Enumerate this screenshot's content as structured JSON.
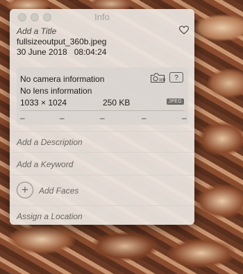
{
  "window": {
    "title": "Info"
  },
  "photo": {
    "title_placeholder": "Add a Title",
    "filename": "fullsizeoutput_360b.jpeg",
    "date": "30 June 2018",
    "time": "08:04:24"
  },
  "camera": {
    "camera_info": "No camera information",
    "lens_info": "No lens information",
    "dimensions": "1033 × 1024",
    "file_size": "250 KB",
    "format_badge": "JPEG",
    "wb_label": "WB",
    "help_label": "?",
    "exif_placeholders": [
      "–",
      "–",
      "–",
      "–",
      "–"
    ]
  },
  "fields": {
    "description_placeholder": "Add a Description",
    "keyword_placeholder": "Add a Keyword",
    "faces_label": "Add Faces",
    "faces_button_glyph": "+",
    "location_placeholder": "Assign a Location"
  },
  "icons": {
    "favorite": "heart-icon",
    "white_balance": "camera-wb-icon"
  }
}
